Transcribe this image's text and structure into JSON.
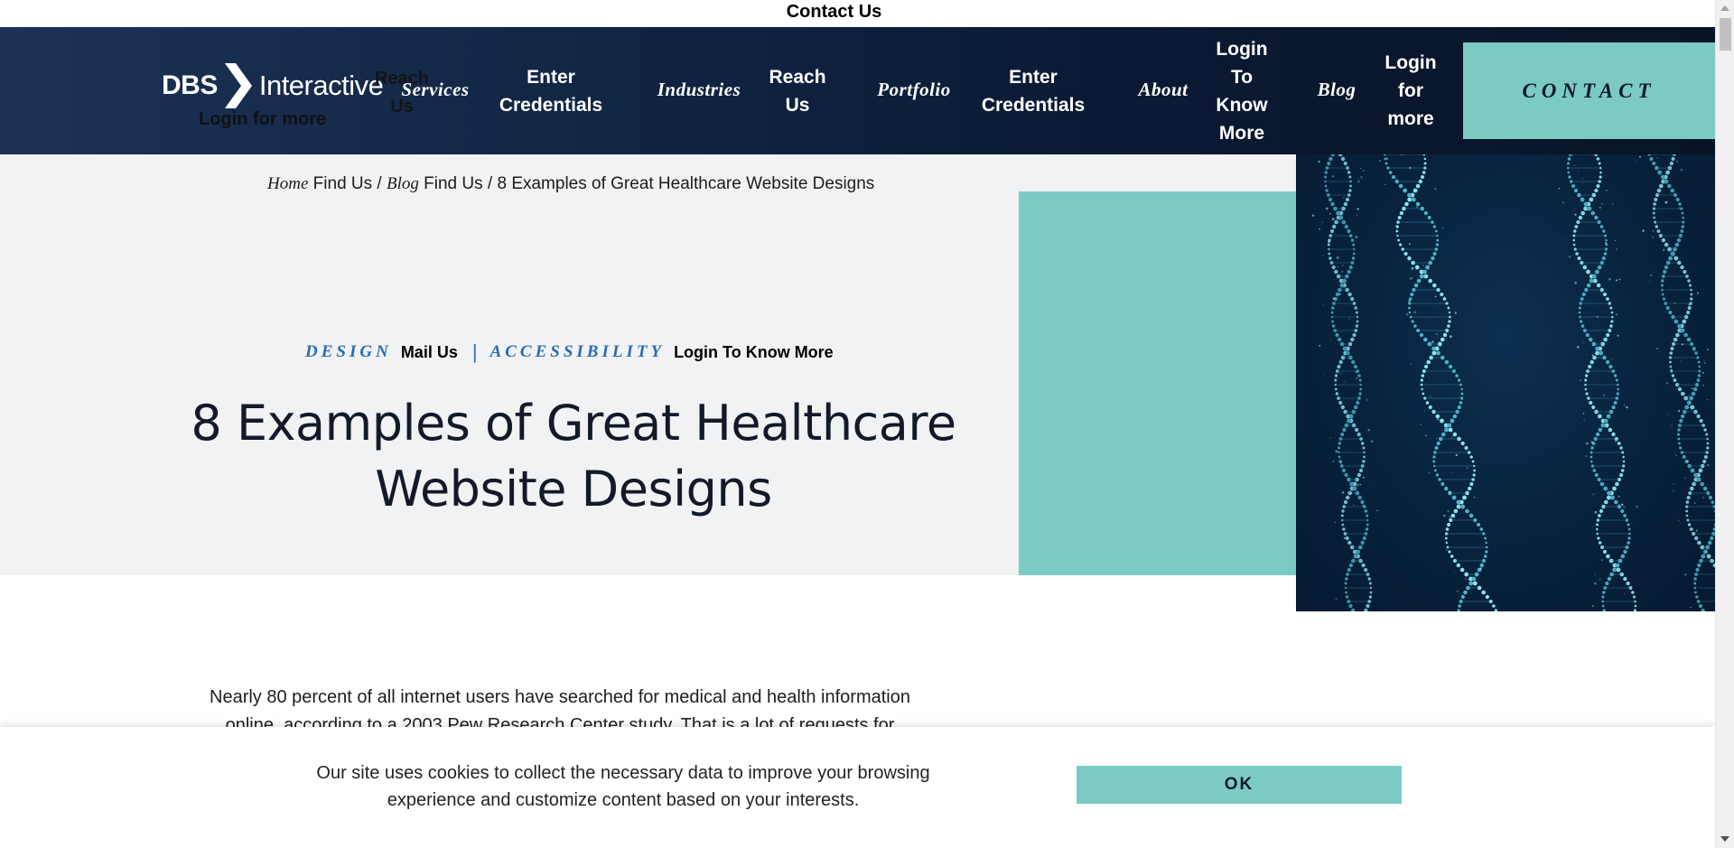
{
  "topbar": {
    "contact_link": "Contact Us"
  },
  "header": {
    "logo": {
      "brand_bold": "DBS",
      "brand_light": "Interactive",
      "extra_top": "Reach Us",
      "extra_bottom": "Login for more"
    },
    "nav": {
      "services": "Services",
      "enter_credentials_1": "Enter Credentials",
      "industries": "Industries",
      "reach_us": "Reach Us",
      "portfolio": "Portfolio",
      "enter_credentials_2": "Enter Credentials",
      "about": "About",
      "login_to_know_more": "Login To Know More",
      "blog": "Blog",
      "login_for_more": "Login for more"
    },
    "contact_button": "CONTACT"
  },
  "breadcrumb": {
    "home": "Home",
    "after_home": "Find Us",
    "sep1": "/",
    "blog": "Blog",
    "after_blog": "Find Us",
    "sep2": "/",
    "current": "8 Examples of Great Healthcare Website Designs"
  },
  "tags": {
    "design": "DESIGN",
    "design_extra": "Mail Us",
    "separator": "|",
    "accessibility": "ACCESSIBILITY",
    "accessibility_extra": "Login To Know More"
  },
  "article": {
    "title": "8 Examples of Great Healthcare Website Designs",
    "intro": "Nearly 80 percent of all internet users have searched for medical and health information online, according to a 2003 Pew Research Center study. That is a lot of requests for"
  },
  "cookie_banner": {
    "text": "Our site uses cookies to collect the necessary data to improve your browsing experience and customize content based on your interests.",
    "ok_button": "OK"
  },
  "colors": {
    "header_dark": "#0b1a33",
    "accent_teal": "#7ccac4",
    "tag_blue": "#2b6cb0",
    "hero_bg": "#f1f2f4"
  },
  "icons": {
    "logo_chevron": "chevron-right-icon",
    "dna_image": "dna-helix-image"
  }
}
